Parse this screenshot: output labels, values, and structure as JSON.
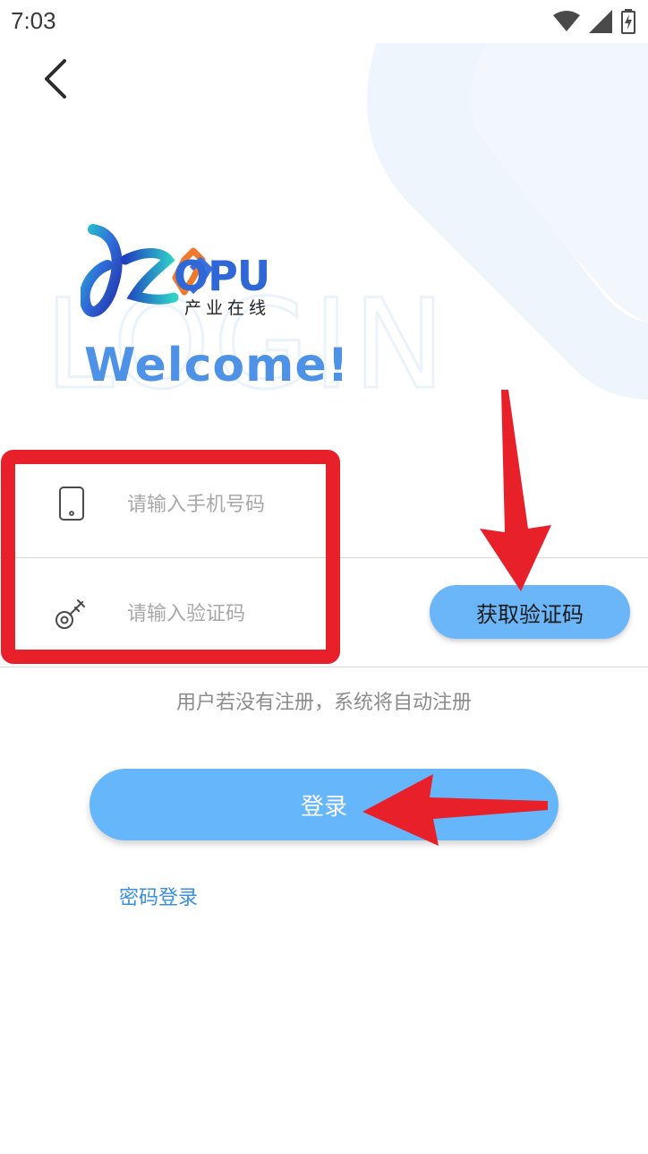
{
  "status_bar": {
    "time": "7:03",
    "icons": [
      "wifi-icon",
      "signal-icon",
      "battery-charging-icon"
    ]
  },
  "nav": {
    "back_icon": "chevron-left-icon"
  },
  "brand": {
    "logo_text": "OPU",
    "logo_subtitle": "产业在线",
    "background_word": "LOGIN",
    "welcome": "Welcome!"
  },
  "form": {
    "phone": {
      "icon": "phone-icon",
      "value": "",
      "placeholder": "请输入手机号码"
    },
    "code": {
      "icon": "key-icon",
      "value": "",
      "placeholder": "请输入验证码"
    },
    "get_code_label": "获取验证码",
    "hint": "用户若没有注册，系统将自动注册",
    "login_label": "登录",
    "password_login_label": "密码登录"
  },
  "colors": {
    "accent_blue": "#66b6fb",
    "welcome_blue": "#4d92e6",
    "link_blue": "#3a8fe0",
    "annotation_red": "#e8202a"
  }
}
